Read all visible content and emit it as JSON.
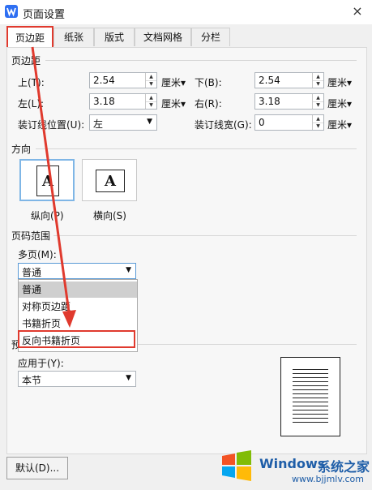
{
  "window": {
    "title": "页面设置",
    "close": "×"
  },
  "tabs": [
    {
      "label": "页边距"
    },
    {
      "label": "纸张"
    },
    {
      "label": "版式"
    },
    {
      "label": "文档网格"
    },
    {
      "label": "分栏"
    }
  ],
  "margins": {
    "section": "页边距",
    "top_label": "上(T):",
    "top_value": "2.54",
    "bottom_label": "下(B):",
    "bottom_value": "2.54",
    "left_label": "左(L):",
    "left_value": "3.18",
    "right_label": "右(R):",
    "right_value": "3.18",
    "gutter_pos_label": "装订线位置(U):",
    "gutter_pos_value": "左",
    "gutter_width_label": "装订线宽(G):",
    "gutter_width_value": "0",
    "unit": "厘米▾"
  },
  "orientation": {
    "section": "方向",
    "portrait": "纵向(P)",
    "landscape": "横向(S)",
    "glyph": "A"
  },
  "page_range": {
    "section": "页码范围",
    "multi_label": "多页(M):",
    "multi_value": "普通",
    "options": [
      "普通",
      "对称页边距",
      "书籍折页",
      "反向书籍折页"
    ]
  },
  "preview": {
    "section_char": "预",
    "apply_label": "应用于(Y):",
    "apply_value": "本节"
  },
  "buttons": {
    "default": "默认(D)..."
  },
  "watermark": {
    "brand": "Windows",
    "brand_cn": "系统之家",
    "url": "www.bjjmlv.com"
  }
}
